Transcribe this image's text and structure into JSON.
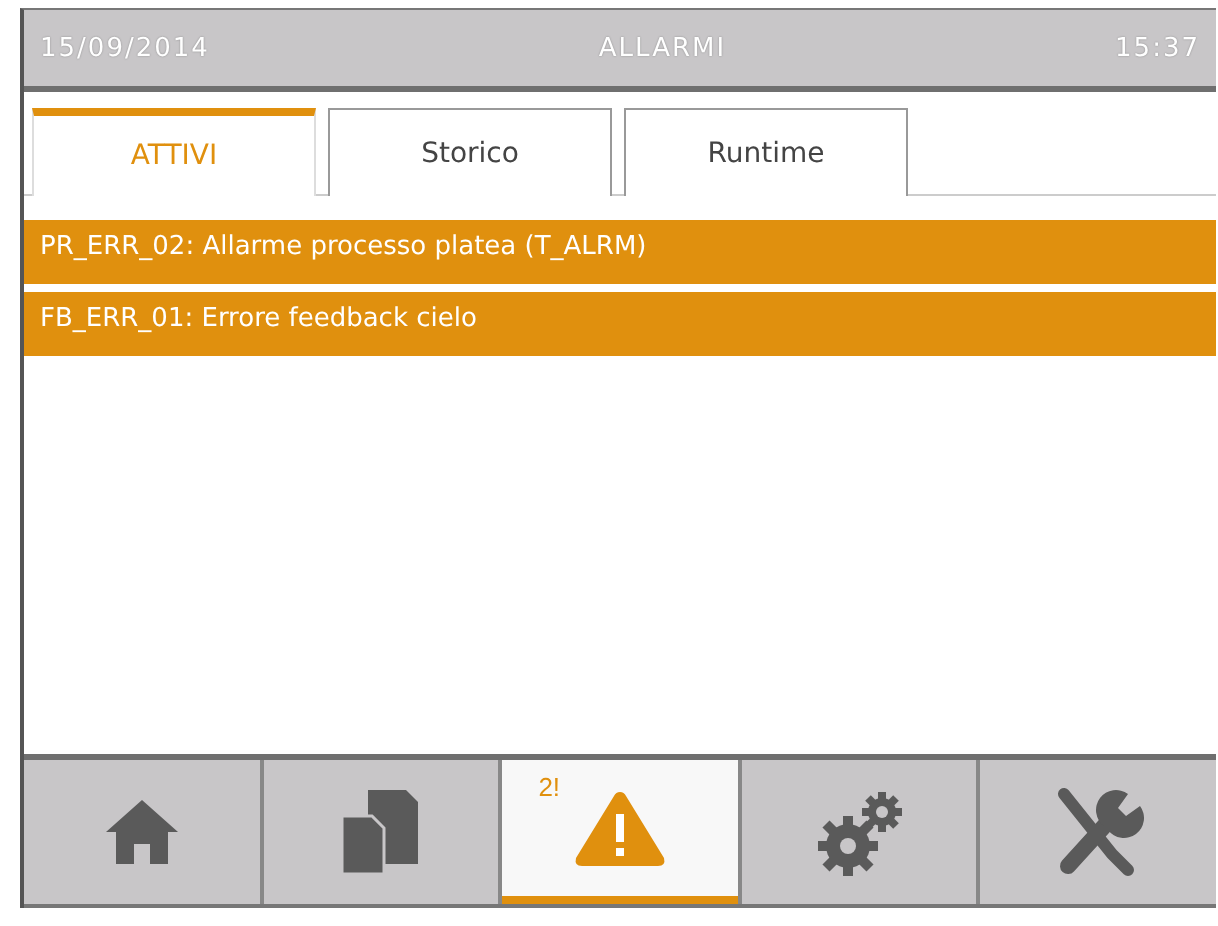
{
  "header": {
    "date": "15/09/2014",
    "title": "ALLARMI",
    "time": "15:37"
  },
  "tabs": [
    {
      "label": "ATTIVI",
      "selected": true
    },
    {
      "label": "Storico",
      "selected": false
    },
    {
      "label": "Runtime",
      "selected": false
    }
  ],
  "alarms": [
    "PR_ERR_02: Allarme processo platea (T_ALRM)",
    "FB_ERR_01: Errore feedback cielo"
  ],
  "nav": [
    {
      "kind": "home",
      "selected": false
    },
    {
      "kind": "documents",
      "selected": false
    },
    {
      "kind": "alarm",
      "selected": true,
      "badge": "2!"
    },
    {
      "kind": "settings",
      "selected": false
    },
    {
      "kind": "tools",
      "selected": false
    }
  ]
}
